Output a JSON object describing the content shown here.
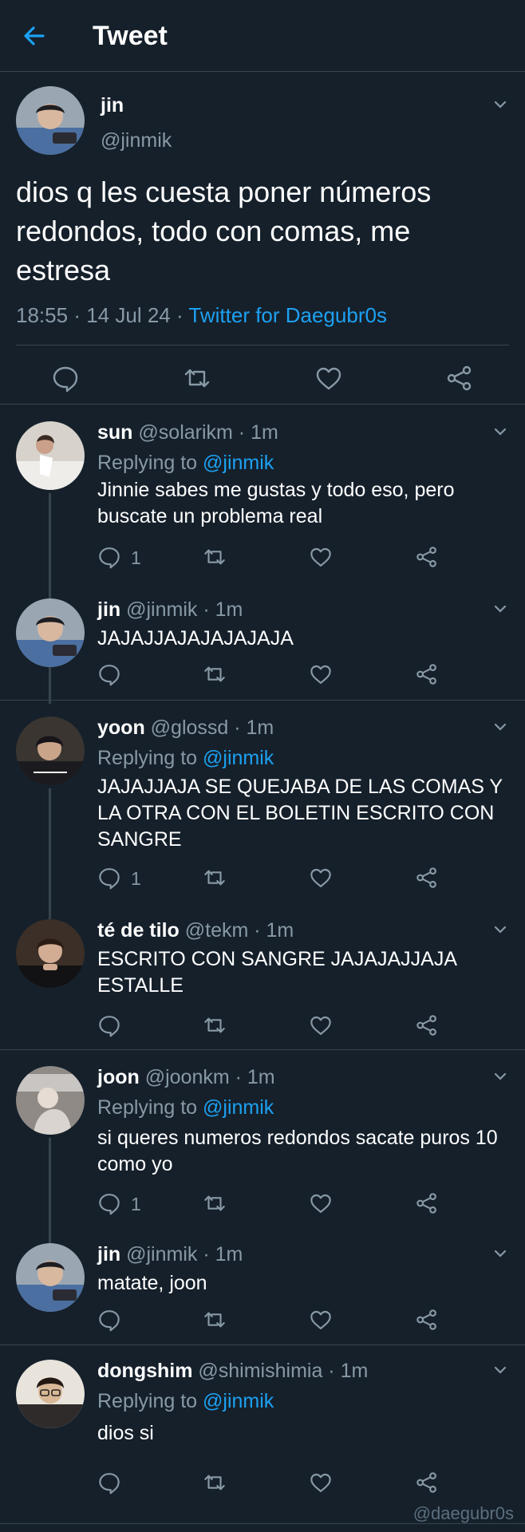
{
  "header": {
    "title": "Tweet",
    "back_icon": "arrow-left-icon"
  },
  "main_tweet": {
    "name": "jin",
    "handle": "@jinmik",
    "text": "dios q les cuesta poner números redondos, todo con comas, me estresa",
    "time": "18:55",
    "date": "14 Jul 24",
    "dot": "·",
    "source": "Twitter for Daegubr0s"
  },
  "replies": [
    {
      "name": "sun",
      "meta": "@solarikm · 1m",
      "replying_prefix": "Replying to ",
      "replying_to": "@jinmik",
      "text": "Jinnie sabes me gustas y todo eso, pero buscate un problema real",
      "reply_count": "1"
    },
    {
      "name": "jin",
      "meta": "@jinmik · 1m",
      "text": "JAJAJJAJAJAJAJAJA",
      "reply_count": ""
    },
    {
      "name": "yoon",
      "meta": "@glossd · 1m",
      "replying_prefix": "Replying to ",
      "replying_to": "@jinmik",
      "text": "JAJAJJAJA SE QUEJABA DE LAS COMAS Y LA OTRA CON EL BOLETIN ESCRITO CON SANGRE",
      "reply_count": "1"
    },
    {
      "name": "té de tilo",
      "meta": "@tekm · 1m",
      "text": "ESCRITO CON SANGRE JAJAJAJJAJA ESTALLE",
      "reply_count": ""
    },
    {
      "name": "joon",
      "meta": "@joonkm · 1m",
      "replying_prefix": "Replying to ",
      "replying_to": "@jinmik",
      "text": "si queres numeros redondos sacate puros 10 como yo",
      "reply_count": "1"
    },
    {
      "name": "jin",
      "meta": "@jinmik · 1m",
      "text": "matate, joon",
      "reply_count": ""
    },
    {
      "name": "dongshim",
      "meta": "@shimishimia · 1m",
      "replying_prefix": "Replying to ",
      "replying_to": "@jinmik",
      "text": "dios si",
      "reply_count": ""
    }
  ],
  "watermark": "@daegubr0s",
  "colors": {
    "background": "#15202b",
    "accent": "#1da1f2",
    "muted": "#8899a6",
    "border": "#38444d"
  }
}
